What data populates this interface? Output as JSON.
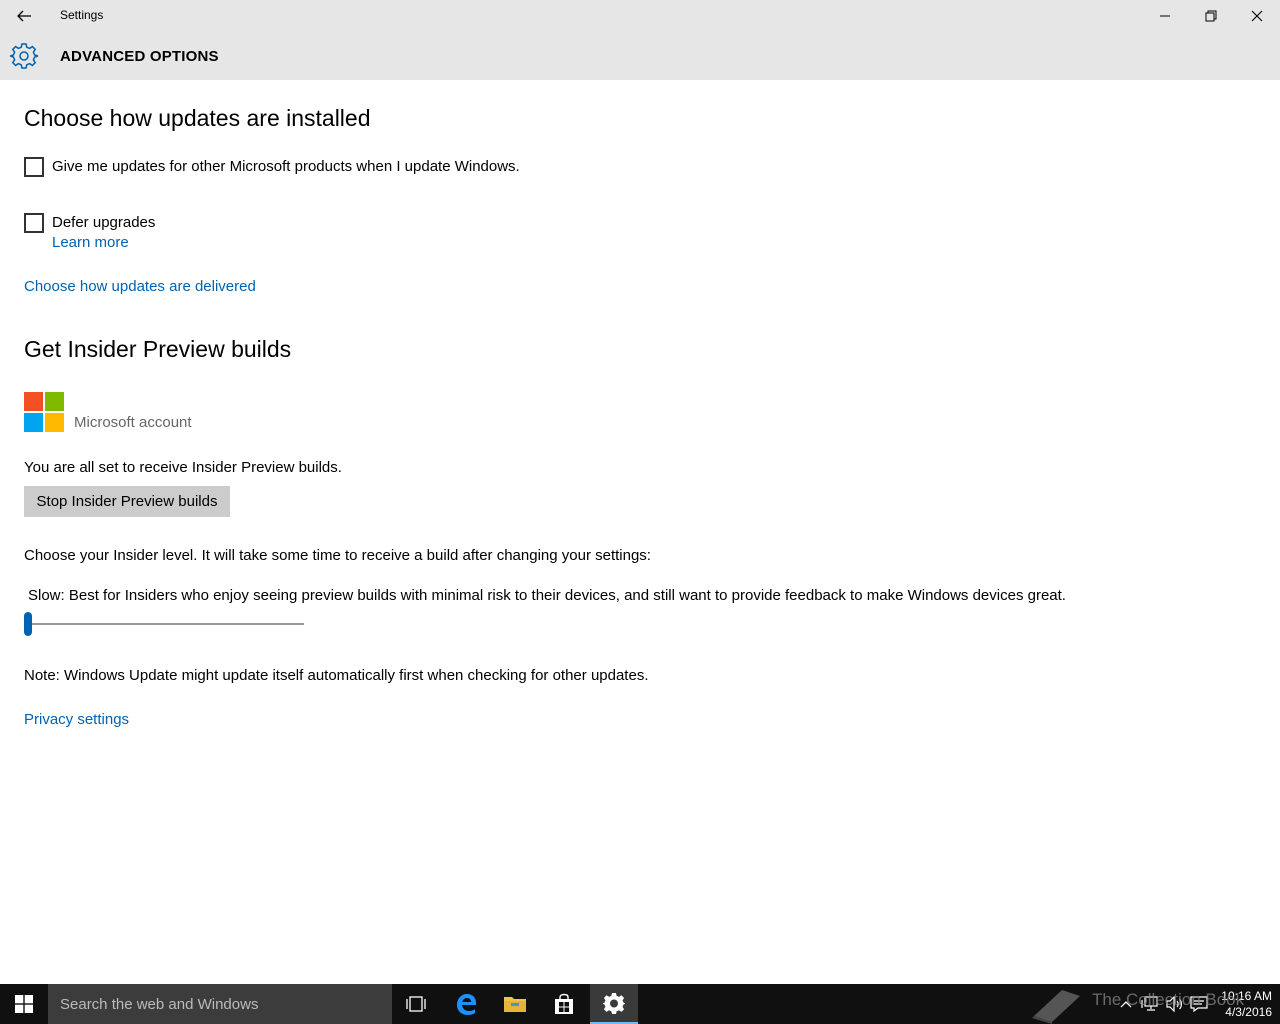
{
  "window": {
    "title": "Settings",
    "minimize_icon": "minimize-icon",
    "maximize_icon": "restore-icon",
    "close_icon": "close-icon"
  },
  "header": {
    "icon": "gear-icon",
    "title": "ADVANCED OPTIONS"
  },
  "install_section": {
    "heading": "Choose how updates are installed",
    "other_products_label": "Give me updates for other Microsoft products when I update Windows.",
    "other_products_checked": false,
    "defer_label": "Defer upgrades",
    "defer_checked": false,
    "learn_more": "Learn more",
    "delivery_link": "Choose how updates are delivered"
  },
  "insider_section": {
    "heading": "Get Insider Preview builds",
    "account_label": "Microsoft account",
    "status_text": "You are all set to receive Insider Preview builds.",
    "stop_button": "Stop Insider Preview builds",
    "level_prompt": "Choose your Insider level. It will take some time to receive a build after changing your settings:",
    "level_description": "Slow: Best for Insiders who enjoy seeing preview builds with minimal risk to their devices, and still want to provide feedback to make Windows devices great.",
    "level_slider_value": 0
  },
  "note_text": "Note: Windows Update might update itself automatically first when checking for other updates.",
  "privacy_link": "Privacy settings",
  "colors": {
    "accent": "#0063b1",
    "chrome": "#e6e6e6",
    "taskbar": "#101010",
    "ms_red": "#f25022",
    "ms_green": "#7fba00",
    "ms_blue": "#00a4ef",
    "ms_yellow": "#ffb900"
  },
  "taskbar": {
    "search_placeholder": "Search the web and Windows",
    "time": "10:16 AM",
    "date": "4/3/2016",
    "watermark": "The Collection Book"
  }
}
